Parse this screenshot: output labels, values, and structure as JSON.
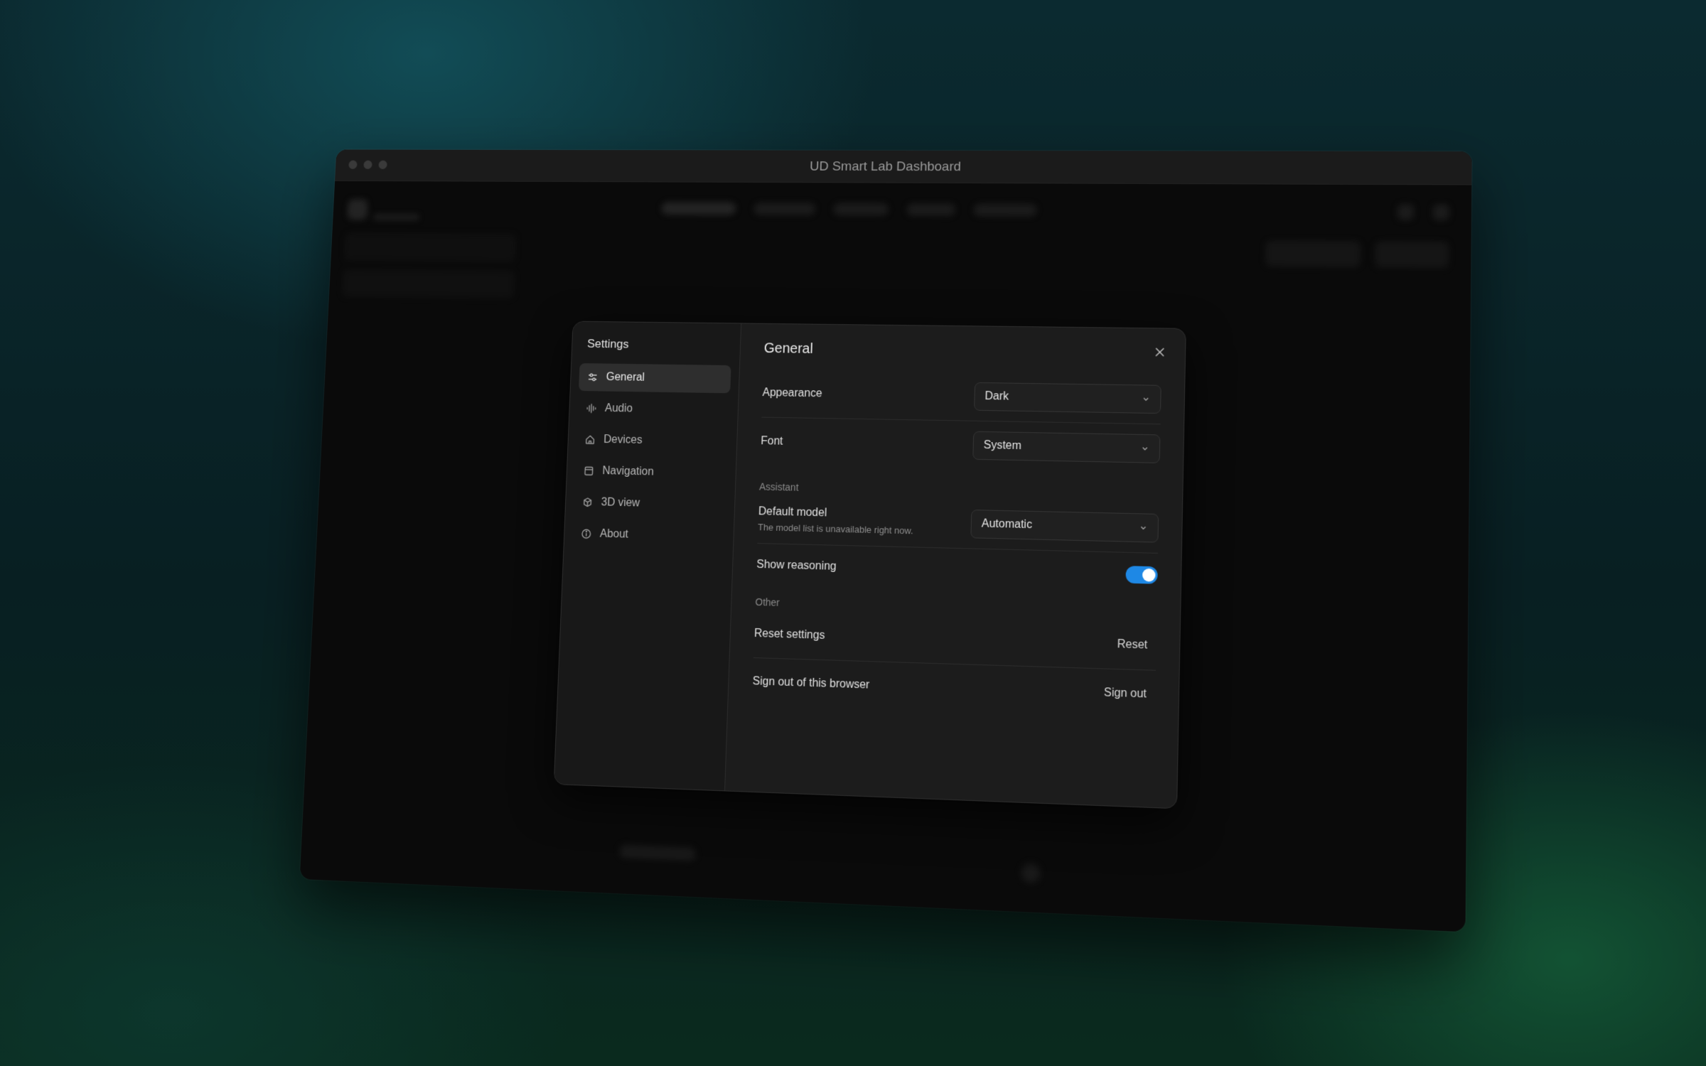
{
  "window": {
    "title": "UD Smart Lab Dashboard"
  },
  "settings": {
    "sidebar_title": "Settings",
    "items": [
      {
        "label": "General",
        "icon": "sliders-icon",
        "active": true
      },
      {
        "label": "Audio",
        "icon": "waveform-icon",
        "active": false
      },
      {
        "label": "Devices",
        "icon": "home-icon",
        "active": false
      },
      {
        "label": "Navigation",
        "icon": "panel-icon",
        "active": false
      },
      {
        "label": "3D view",
        "icon": "cube-rotate-icon",
        "active": false
      },
      {
        "label": "About",
        "icon": "info-icon",
        "active": false
      }
    ],
    "main": {
      "title": "General",
      "appearance": {
        "label": "Appearance",
        "value": "Dark"
      },
      "font": {
        "label": "Font",
        "value": "System"
      },
      "assistant_section": "Assistant",
      "default_model": {
        "label": "Default model",
        "hint": "The model list is unavailable right now.",
        "value": "Automatic"
      },
      "show_reasoning": {
        "label": "Show reasoning",
        "enabled": true
      },
      "other_section": "Other",
      "reset": {
        "label": "Reset settings",
        "button": "Reset"
      },
      "sign_out": {
        "label": "Sign out of this browser",
        "button": "Sign out"
      }
    }
  },
  "colors": {
    "accent": "#1e88e5",
    "modal_bg": "#1c1c1c",
    "window_bg": "#0a0a0a"
  }
}
